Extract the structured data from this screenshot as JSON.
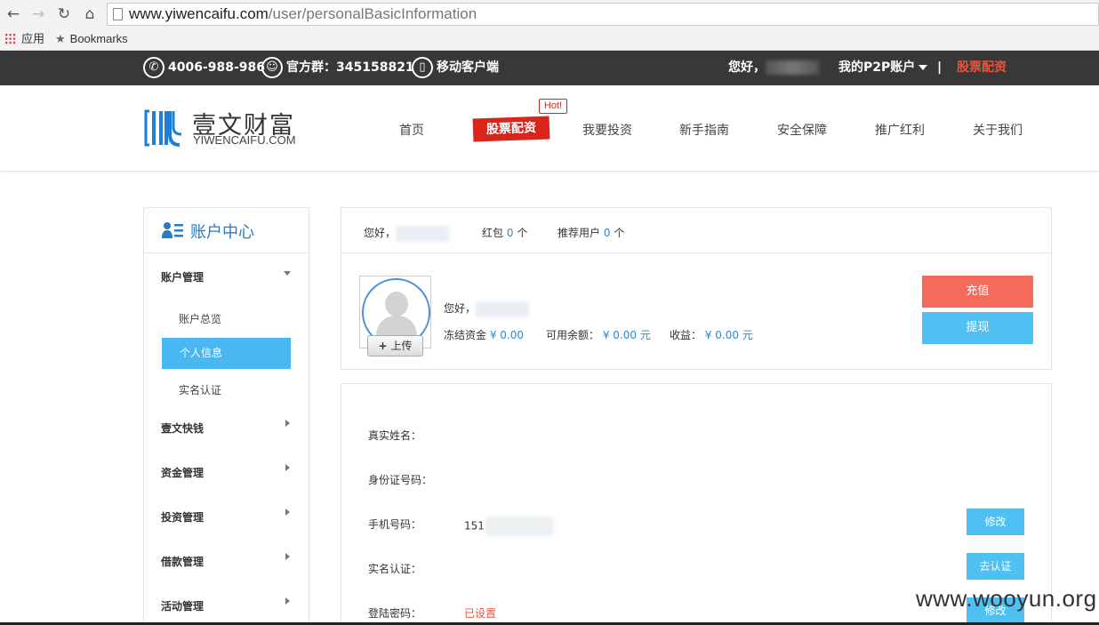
{
  "browser": {
    "url_host": "www.yiwencaifu.com",
    "url_path": "/user/personalBasicInformation",
    "bookmarks": {
      "apps_label": "应用",
      "bookmarks_label": "Bookmarks"
    }
  },
  "topbar": {
    "phone": "4006-988-986",
    "qq_group": "官方群：345158821",
    "mobile": "移动客户端",
    "greeting": "您好，",
    "account_menu": "我的P2P账户",
    "separator": "|",
    "stock_link": "股票配资"
  },
  "header": {
    "logo_cn": "壹文财富",
    "logo_en": "YIWENCAIFU.COM",
    "nav": {
      "home": "首页",
      "stock": "股票配资",
      "hot": "Hot!",
      "invest": "我要投资",
      "guide": "新手指南",
      "security": "安全保障",
      "promo": "推广红利",
      "about": "关于我们"
    }
  },
  "sidebar": {
    "title": "账户中心",
    "account_mgmt": "账户管理",
    "overview": "账户总览",
    "personal_info": "个人信息",
    "real_name": "实名认证",
    "quick_money": "壹文快钱",
    "fund_mgmt": "资金管理",
    "invest_mgmt": "投资管理",
    "loan_mgmt": "借款管理",
    "activity_mgmt": "活动管理"
  },
  "greeting_panel": {
    "hello": "您好，",
    "red_packet_label": "红包",
    "red_packet_count": "0",
    "unit": "个",
    "referral_label": "推荐用户",
    "referral_count": "0"
  },
  "account_panel": {
    "upload": "上传",
    "hello": "您好，",
    "frozen_label": "冻结资金",
    "frozen_value": "¥ 0.00",
    "balance_label": "可用余额：",
    "balance_value": "¥ 0.00 元",
    "income_label": "收益：",
    "income_value": "¥ 0.00 元",
    "recharge": "充值",
    "withdraw": "提现"
  },
  "info_panel": {
    "name_label": "真实姓名：",
    "id_label": "身份证号码：",
    "phone_label": "手机号码：",
    "phone_value": "151",
    "modify": "修改",
    "realname_label": "实名认证：",
    "verify": "去认证",
    "password_label": "登陆密码：",
    "password_value": "已设置",
    "modify2": "修改"
  },
  "watermark": "www.wooyun.org",
  "colors": {
    "topbar_bg": "#383838",
    "accent_blue": "#4ab8f0",
    "recharge_red": "#f46b5e",
    "stock_red": "#d8261c",
    "link_blue": "#2a8bd0"
  }
}
